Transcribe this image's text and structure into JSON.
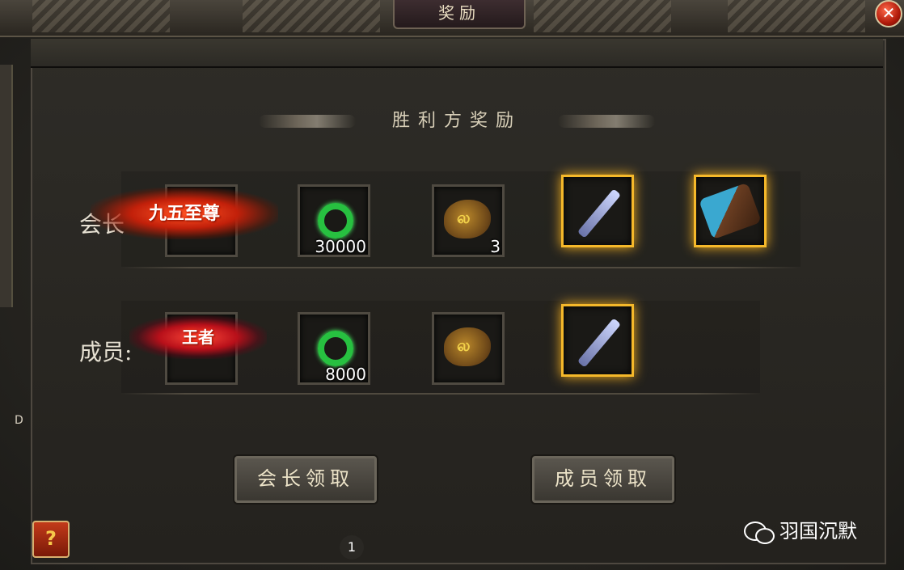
{
  "window": {
    "title": "奖励"
  },
  "close_icon": "close-icon",
  "section": {
    "title": "胜利方奖励"
  },
  "rows": {
    "leader": {
      "label": "会长",
      "badge": "九五至尊",
      "jade_qty": "30000",
      "rune_qty": "3"
    },
    "member": {
      "label": "成员:",
      "badge": "王者",
      "jade_qty": "8000"
    }
  },
  "buttons": {
    "leader_claim": "会长领取",
    "member_claim": "成员领取",
    "help": "?"
  },
  "side_letter": "D",
  "page_number": "1",
  "watermark": "羽国沉默",
  "colors": {
    "glow": "#f5b82a",
    "accent_red": "#c2200a"
  }
}
